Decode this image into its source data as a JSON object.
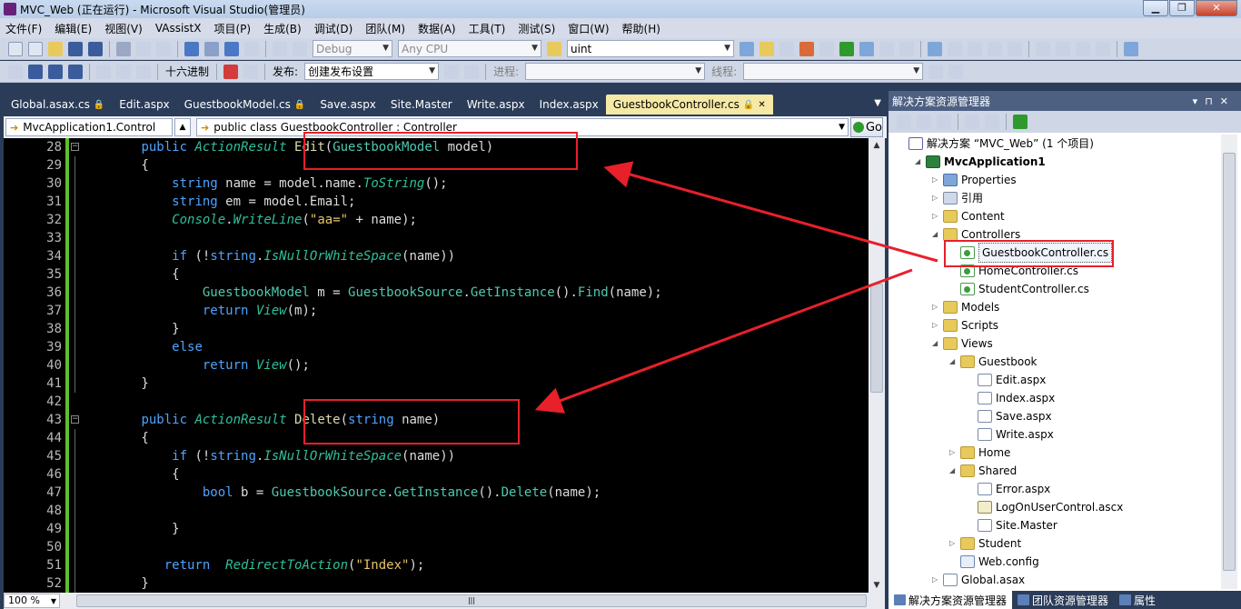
{
  "window": {
    "title": "MVC_Web (正在运行) - Microsoft Visual Studio(管理员)"
  },
  "menu": [
    "文件(F)",
    "编辑(E)",
    "视图(V)",
    "VAssistX",
    "项目(P)",
    "生成(B)",
    "调试(D)",
    "团队(M)",
    "数据(A)",
    "工具(T)",
    "测试(S)",
    "窗口(W)",
    "帮助(H)"
  ],
  "toolbar": {
    "config": "Debug",
    "platform": "Any CPU",
    "find": "uint",
    "hex_label": "十六进制",
    "publish_label": "发布:",
    "publish_value": "创建发布设置",
    "process_label": "进程:",
    "thread_label": "线程:"
  },
  "tabs": [
    {
      "label": "Global.asax.cs",
      "pinned": true
    },
    {
      "label": "Edit.aspx",
      "pinned": false
    },
    {
      "label": "GuestbookModel.cs",
      "pinned": true
    },
    {
      "label": "Save.aspx",
      "pinned": false
    },
    {
      "label": "Site.Master",
      "pinned": false
    },
    {
      "label": "Write.aspx",
      "pinned": false
    },
    {
      "label": "Index.aspx",
      "pinned": false
    },
    {
      "label": "GuestbookController.cs",
      "pinned": true,
      "active": true
    }
  ],
  "navbar": {
    "type_combo": "MvcApplication1.Control",
    "member_combo": "public class GuestbookController : Controller",
    "go_label": "Go"
  },
  "editor": {
    "zoom": "100 %",
    "lines": [
      {
        "n": "28",
        "tokens": [
          [
            "        ",
            "pl"
          ],
          [
            "public ",
            "kw"
          ],
          [
            "ActionResult ",
            "ty"
          ],
          [
            "Edit",
            "mt"
          ],
          [
            "(",
            "pl"
          ],
          [
            "GuestbookModel",
            "cl"
          ],
          [
            " model)",
            "pl"
          ]
        ]
      },
      {
        "n": "29",
        "tokens": [
          [
            "        {",
            "pl"
          ]
        ]
      },
      {
        "n": "30",
        "tokens": [
          [
            "            ",
            "pl"
          ],
          [
            "string ",
            "kw"
          ],
          [
            "name = model.name.",
            "pl"
          ],
          [
            "ToString",
            "ty"
          ],
          [
            "();",
            "pl"
          ]
        ]
      },
      {
        "n": "31",
        "tokens": [
          [
            "            ",
            "pl"
          ],
          [
            "string ",
            "kw"
          ],
          [
            "em = model.Email;",
            "pl"
          ]
        ]
      },
      {
        "n": "32",
        "tokens": [
          [
            "            ",
            "pl"
          ],
          [
            "Console",
            "ty"
          ],
          [
            ".",
            "pl"
          ],
          [
            "WriteLine",
            "ty"
          ],
          [
            "(",
            "pl"
          ],
          [
            "\"aa=\"",
            "st"
          ],
          [
            " + name);",
            "pl"
          ]
        ]
      },
      {
        "n": "33",
        "tokens": [
          [
            "",
            "pl"
          ]
        ]
      },
      {
        "n": "34",
        "tokens": [
          [
            "            ",
            "pl"
          ],
          [
            "if ",
            "kw"
          ],
          [
            "(!",
            "pl"
          ],
          [
            "string",
            "kw"
          ],
          [
            ".",
            "pl"
          ],
          [
            "IsNullOrWhiteSpace",
            "ty"
          ],
          [
            "(name))",
            "pl"
          ]
        ]
      },
      {
        "n": "35",
        "tokens": [
          [
            "            {",
            "pl"
          ]
        ]
      },
      {
        "n": "36",
        "tokens": [
          [
            "                ",
            "pl"
          ],
          [
            "GuestbookModel",
            "cl"
          ],
          [
            " m = ",
            "pl"
          ],
          [
            "GuestbookSource",
            "cl"
          ],
          [
            ".",
            "pl"
          ],
          [
            "GetInstance",
            "cl"
          ],
          [
            "().",
            "pl"
          ],
          [
            "Find",
            "cl"
          ],
          [
            "(name);",
            "pl"
          ]
        ]
      },
      {
        "n": "37",
        "tokens": [
          [
            "                ",
            "pl"
          ],
          [
            "return ",
            "kw"
          ],
          [
            "View",
            "ty"
          ],
          [
            "(m);",
            "pl"
          ]
        ]
      },
      {
        "n": "38",
        "tokens": [
          [
            "            }",
            "pl"
          ]
        ]
      },
      {
        "n": "39",
        "tokens": [
          [
            "            ",
            "pl"
          ],
          [
            "else",
            "kw"
          ]
        ]
      },
      {
        "n": "40",
        "tokens": [
          [
            "                ",
            "pl"
          ],
          [
            "return ",
            "kw"
          ],
          [
            "View",
            "ty"
          ],
          [
            "();",
            "pl"
          ]
        ]
      },
      {
        "n": "41",
        "tokens": [
          [
            "        }",
            "pl"
          ]
        ]
      },
      {
        "n": "42",
        "tokens": [
          [
            "",
            "pl"
          ]
        ]
      },
      {
        "n": "43",
        "tokens": [
          [
            "        ",
            "pl"
          ],
          [
            "public ",
            "kw"
          ],
          [
            "ActionResult ",
            "ty"
          ],
          [
            "Delete",
            "mt"
          ],
          [
            "(",
            "pl"
          ],
          [
            "string ",
            "kw"
          ],
          [
            "name)",
            "pl"
          ]
        ]
      },
      {
        "n": "44",
        "tokens": [
          [
            "        {",
            "pl"
          ]
        ]
      },
      {
        "n": "45",
        "tokens": [
          [
            "            ",
            "pl"
          ],
          [
            "if ",
            "kw"
          ],
          [
            "(!",
            "pl"
          ],
          [
            "string",
            "kw"
          ],
          [
            ".",
            "pl"
          ],
          [
            "IsNullOrWhiteSpace",
            "ty"
          ],
          [
            "(name))",
            "pl"
          ]
        ]
      },
      {
        "n": "46",
        "tokens": [
          [
            "            {",
            "pl"
          ]
        ]
      },
      {
        "n": "47",
        "tokens": [
          [
            "                ",
            "pl"
          ],
          [
            "bool ",
            "kw"
          ],
          [
            "b = ",
            "pl"
          ],
          [
            "GuestbookSource",
            "cl"
          ],
          [
            ".",
            "pl"
          ],
          [
            "GetInstance",
            "cl"
          ],
          [
            "().",
            "pl"
          ],
          [
            "Delete",
            "cl"
          ],
          [
            "(name);",
            "pl"
          ]
        ]
      },
      {
        "n": "48",
        "tokens": [
          [
            "",
            "pl"
          ]
        ]
      },
      {
        "n": "49",
        "tokens": [
          [
            "            }",
            "pl"
          ]
        ]
      },
      {
        "n": "50",
        "tokens": [
          [
            "",
            "pl"
          ]
        ]
      },
      {
        "n": "51",
        "tokens": [
          [
            "           ",
            "pl"
          ],
          [
            "return  ",
            "kw"
          ],
          [
            "RedirectToAction",
            "ty"
          ],
          [
            "(",
            "pl"
          ],
          [
            "\"Index\"",
            "st"
          ],
          [
            ");",
            "pl"
          ]
        ]
      },
      {
        "n": "52",
        "tokens": [
          [
            "        }",
            "pl"
          ]
        ]
      }
    ]
  },
  "solution_explorer": {
    "title": "解决方案资源管理器",
    "items": [
      {
        "label": "解决方案 “MVC_Web” (1 个项目)",
        "depth": 0,
        "icon": "sol",
        "arrow": ""
      },
      {
        "label": "MvcApplication1",
        "depth": 1,
        "icon": "proj",
        "arrow": "◢",
        "bold": true
      },
      {
        "label": "Properties",
        "depth": 2,
        "icon": "props",
        "arrow": "▷"
      },
      {
        "label": "引用",
        "depth": 2,
        "icon": "ref",
        "arrow": "▷"
      },
      {
        "label": "Content",
        "depth": 2,
        "icon": "folder",
        "arrow": "▷"
      },
      {
        "label": "Controllers",
        "depth": 2,
        "icon": "folder",
        "arrow": "◢"
      },
      {
        "label": "GuestbookController.cs",
        "depth": 3,
        "icon": "cs",
        "arrow": "",
        "selected": true
      },
      {
        "label": "HomeController.cs",
        "depth": 3,
        "icon": "cs",
        "arrow": ""
      },
      {
        "label": "StudentController.cs",
        "depth": 3,
        "icon": "cs",
        "arrow": ""
      },
      {
        "label": "Models",
        "depth": 2,
        "icon": "folder",
        "arrow": "▷"
      },
      {
        "label": "Scripts",
        "depth": 2,
        "icon": "folder",
        "arrow": "▷"
      },
      {
        "label": "Views",
        "depth": 2,
        "icon": "folder",
        "arrow": "◢"
      },
      {
        "label": "Guestbook",
        "depth": 3,
        "icon": "folder",
        "arrow": "◢"
      },
      {
        "label": "Edit.aspx",
        "depth": 4,
        "icon": "aspx",
        "arrow": ""
      },
      {
        "label": "Index.aspx",
        "depth": 4,
        "icon": "aspx",
        "arrow": ""
      },
      {
        "label": "Save.aspx",
        "depth": 4,
        "icon": "aspx",
        "arrow": ""
      },
      {
        "label": "Write.aspx",
        "depth": 4,
        "icon": "aspx",
        "arrow": ""
      },
      {
        "label": "Home",
        "depth": 3,
        "icon": "folder",
        "arrow": "▷"
      },
      {
        "label": "Shared",
        "depth": 3,
        "icon": "folder",
        "arrow": "◢"
      },
      {
        "label": "Error.aspx",
        "depth": 4,
        "icon": "aspx",
        "arrow": ""
      },
      {
        "label": "LogOnUserControl.ascx",
        "depth": 4,
        "icon": "ascx",
        "arrow": ""
      },
      {
        "label": "Site.Master",
        "depth": 4,
        "icon": "aspx",
        "arrow": ""
      },
      {
        "label": "Student",
        "depth": 3,
        "icon": "folder",
        "arrow": "▷"
      },
      {
        "label": "Web.config",
        "depth": 3,
        "icon": "cfg",
        "arrow": ""
      },
      {
        "label": "Global.asax",
        "depth": 2,
        "icon": "aspx",
        "arrow": "▷"
      }
    ],
    "bottom_tabs": [
      "解决方案资源管理器",
      "团队资源管理器",
      "属性"
    ]
  },
  "colors": {
    "annotation": "#e8202a",
    "frame": "#2b3c59"
  }
}
